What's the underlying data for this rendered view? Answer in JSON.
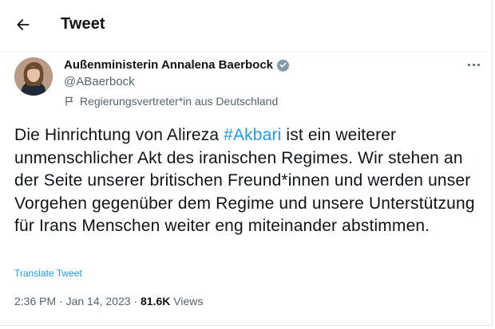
{
  "header": {
    "title": "Tweet",
    "back_icon": "arrow-left-icon"
  },
  "author": {
    "display_name": "Außenministerin Annalena Baerbock",
    "handle": "@ABaerbock",
    "verified_icon": "verified-badge-icon",
    "verified_color": "#829aab",
    "affiliation_icon": "flag-icon",
    "affiliation": "Regierungsvertreter*in aus Deutschland"
  },
  "tweet": {
    "text_before_hashtag": "Die Hinrichtung von Alireza ",
    "hashtag": "#Akbari",
    "text_after_hashtag": " ist ein weiterer unmenschlicher Akt des iranischen Regimes. Wir stehen an der Seite unserer britischen Freund*innen und werden unser Vorgehen gegenüber dem Regime und unsere Unterstützung für Irans Menschen weiter eng miteinander abstimmen.",
    "translate_label": "Translate Tweet"
  },
  "meta": {
    "time": "2:36 PM",
    "separator": "·",
    "date": "Jan 14, 2023",
    "views_count": "81.6K",
    "views_label": "Views"
  },
  "colors": {
    "link": "#1d9bf0",
    "secondary_text": "#536471",
    "primary_text": "#0f1419"
  }
}
